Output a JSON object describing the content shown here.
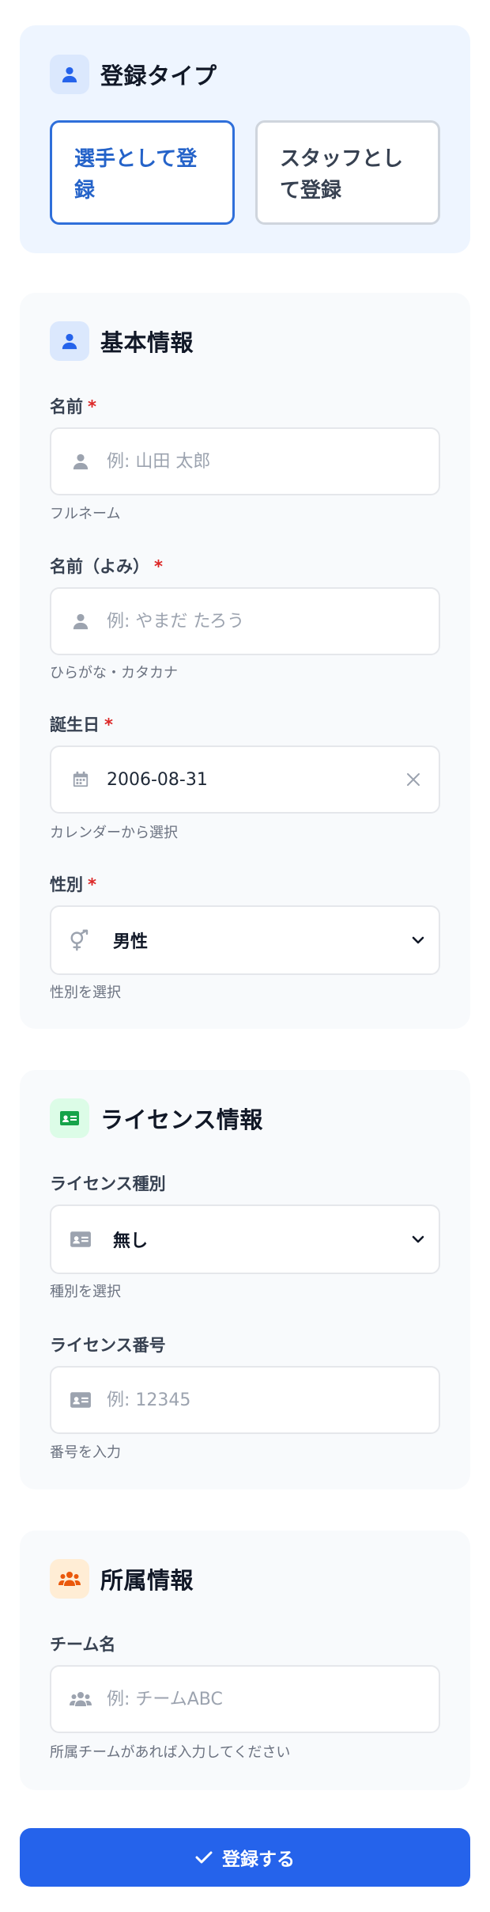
{
  "registration_type": {
    "title": "登録タイプ",
    "options": [
      {
        "label": "選手として登録",
        "selected": true
      },
      {
        "label": "スタッフとして登録",
        "selected": false
      }
    ]
  },
  "basic_info": {
    "title": "基本情報",
    "name": {
      "label": "名前",
      "required_mark": "*",
      "placeholder": "例: 山田 太郎",
      "hint": "フルネーム"
    },
    "name_kana": {
      "label": "名前（よみ）",
      "required_mark": "*",
      "placeholder": "例: やまだ たろう",
      "hint": "ひらがな・カタカナ"
    },
    "birthday": {
      "label": "誕生日",
      "required_mark": "*",
      "value": "2006-08-31",
      "hint": "カレンダーから選択"
    },
    "gender": {
      "label": "性別",
      "required_mark": "*",
      "value": "男性",
      "hint": "性別を選択"
    }
  },
  "license_info": {
    "title": "ライセンス情報",
    "license_type": {
      "label": "ライセンス種別",
      "value": "無し",
      "hint": "種別を選択"
    },
    "license_number": {
      "label": "ライセンス番号",
      "placeholder": "例: 12345",
      "hint": "番号を入力"
    }
  },
  "affiliation": {
    "title": "所属情報",
    "team_name": {
      "label": "チーム名",
      "placeholder": "例: チームABC",
      "hint": "所属チームがあれば入力してください"
    }
  },
  "submit": {
    "label": "登録する"
  },
  "colors": {
    "primary": "#2563eb",
    "required": "#dc2626",
    "license_icon": "#16a34a",
    "team_icon": "#ea580c"
  },
  "icons": {
    "registration_type": "user-icon",
    "basic_info": "user-icon",
    "license_info": "id-card-icon",
    "affiliation": "users-icon",
    "birthday": "calendar-icon",
    "gender": "gender-icon",
    "submit": "check-icon"
  }
}
